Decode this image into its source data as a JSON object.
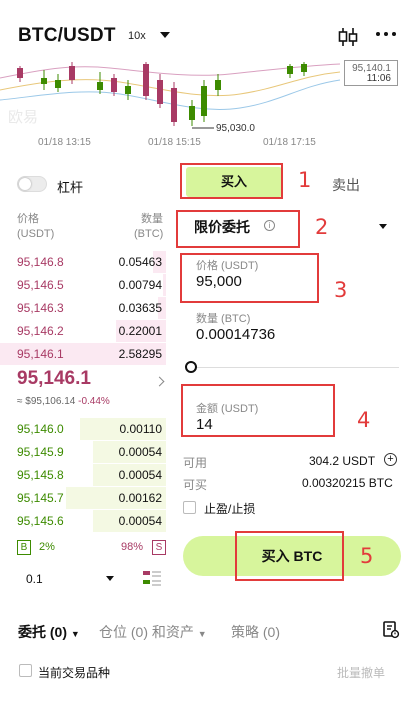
{
  "header": {
    "pair": "BTC/USDT",
    "leverage": "10x"
  },
  "chart": {
    "price_tag_top": "95,140.1",
    "price_tag_time": "11:06",
    "low_marker": "95,030.0",
    "watermark": "欧易",
    "time_labels": [
      "01/18 13:15",
      "01/18 15:15",
      "01/18 17:15"
    ]
  },
  "margin_toggle_label": "杠杆",
  "orderbook": {
    "price_header": "价格",
    "price_unit": "(USDT)",
    "qty_header": "数量",
    "qty_unit": "(BTC)",
    "asks": [
      {
        "price": "95,146.8",
        "qty": "0.05463",
        "depth": 0.08
      },
      {
        "price": "95,146.5",
        "qty": "0.00794",
        "depth": 0.02
      },
      {
        "price": "95,146.3",
        "qty": "0.03635",
        "depth": 0.05
      },
      {
        "price": "95,146.2",
        "qty": "0.22001",
        "depth": 0.3
      },
      {
        "price": "95,146.1",
        "qty": "2.58295",
        "depth": 1.0
      }
    ],
    "last_price": "95,146.1",
    "last_sub": "≈ $95,106.14",
    "last_change": "-0.44%",
    "bids": [
      {
        "price": "95,146.0",
        "qty": "0.00110",
        "depth": 0.52
      },
      {
        "price": "95,145.9",
        "qty": "0.00054",
        "depth": 0.44
      },
      {
        "price": "95,145.8",
        "qty": "0.00054",
        "depth": 0.44
      },
      {
        "price": "95,145.7",
        "qty": "0.00162",
        "depth": 0.6
      },
      {
        "price": "95,145.6",
        "qty": "0.00054",
        "depth": 0.44
      }
    ],
    "buy_badge": "B",
    "buy_pct": "2%",
    "sell_pct": "98%",
    "sell_badge": "S",
    "step": "0.1"
  },
  "form": {
    "buy_tab": "买入",
    "sell_tab": "卖出",
    "order_type": "限价委托",
    "price_label": "价格 (USDT)",
    "price_value": "95,000",
    "qty_label": "数量 (BTC)",
    "qty_value": "0.00014736",
    "amount_label": "金额 (USDT)",
    "amount_value": "14",
    "available_label": "可用",
    "available_value": "304.2 USDT",
    "can_buy_label": "可买",
    "can_buy_value": "0.00320215 BTC",
    "tpsl_label": "止盈/止损",
    "submit": "买入 BTC"
  },
  "annotations": [
    "1",
    "2",
    "3",
    "4",
    "5"
  ],
  "bottom": {
    "tab_orders": "委托 (0)",
    "tab_positions": "仓位 (0) 和资产",
    "tab_strategy": "策略 (0)",
    "current_pair_label": "当前交易品种",
    "cancel_all": "批量撤单"
  },
  "colors": {
    "accent_green": "#d7f59c",
    "ask_red": "#a83a64",
    "bid_green": "#3d8b00",
    "annotation_red": "#e23b3b"
  }
}
